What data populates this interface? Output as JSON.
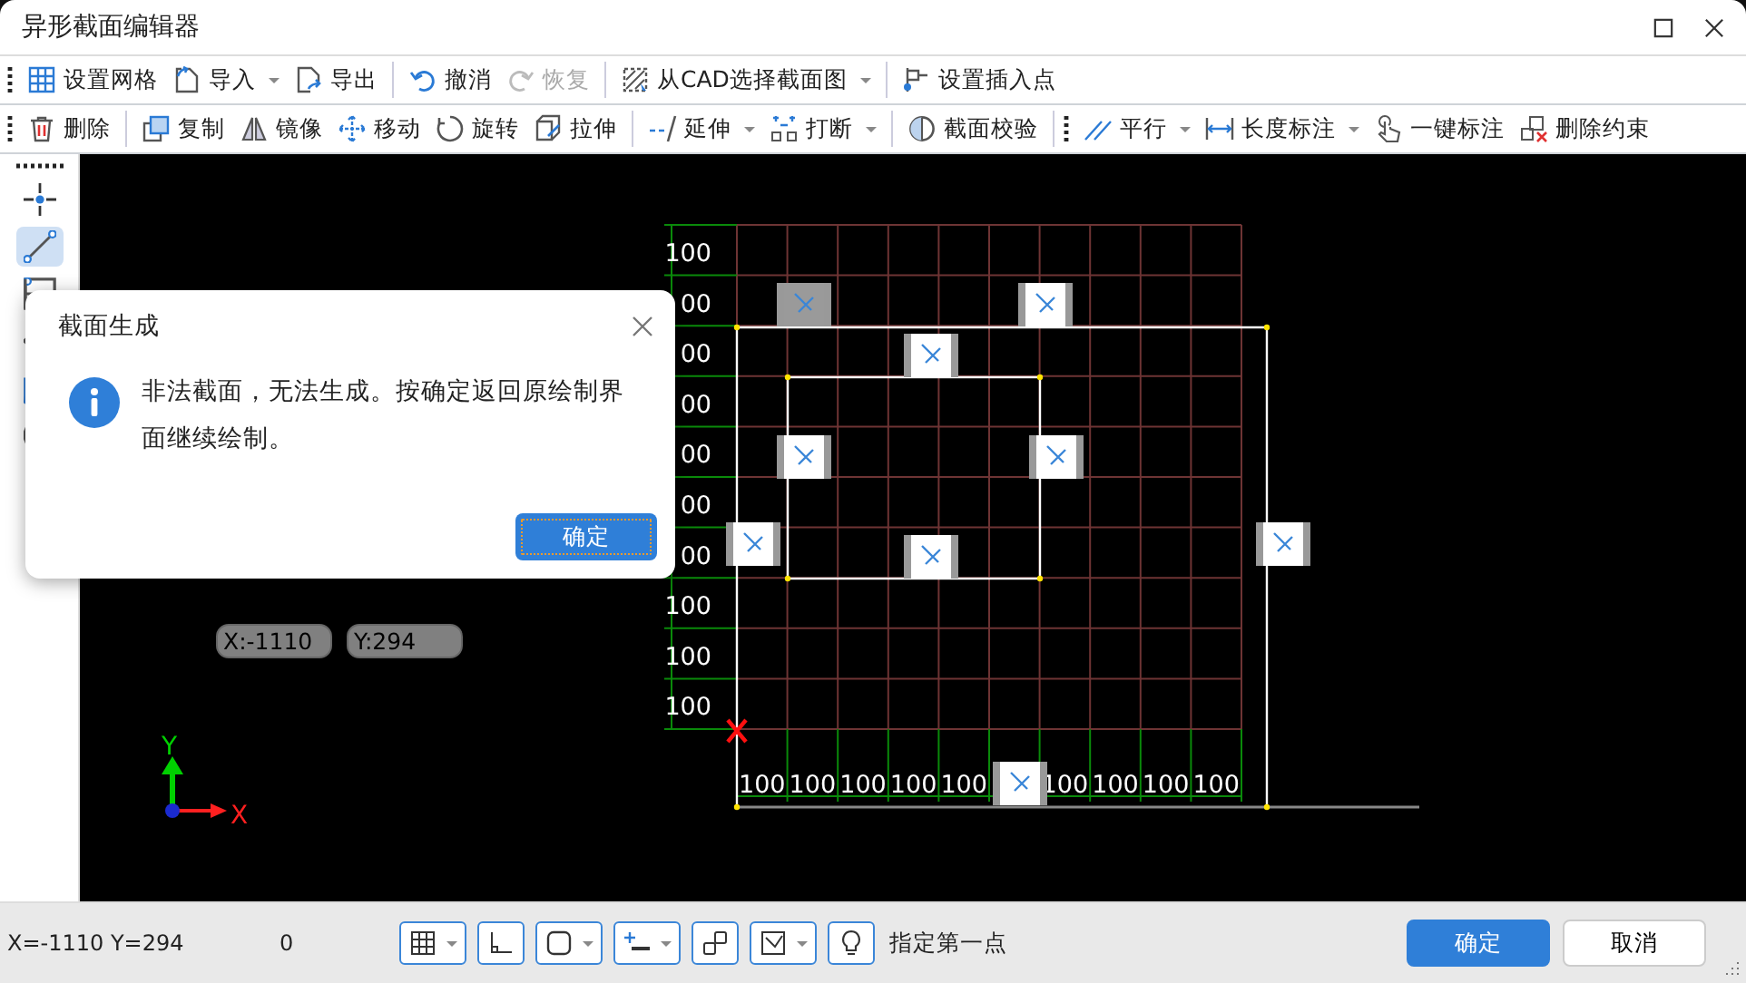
{
  "window": {
    "title": "异形截面编辑器"
  },
  "toolbars": [
    {
      "items": [
        {
          "kind": "grip"
        },
        {
          "kind": "button",
          "label": "设置网格",
          "has_menu": false,
          "disabled": false
        },
        {
          "kind": "button",
          "label": "导入",
          "has_menu": true,
          "disabled": false
        },
        {
          "kind": "button",
          "label": "导出",
          "has_menu": false,
          "disabled": false
        },
        {
          "kind": "separator"
        },
        {
          "kind": "button",
          "label": "撤消",
          "has_menu": false,
          "disabled": false
        },
        {
          "kind": "button",
          "label": "恢复",
          "has_menu": false,
          "disabled": true
        },
        {
          "kind": "separator"
        },
        {
          "kind": "button",
          "label": "从CAD选择截面图",
          "has_menu": true,
          "disabled": false
        },
        {
          "kind": "separator"
        },
        {
          "kind": "button",
          "label": "设置插入点",
          "has_menu": false,
          "disabled": false
        }
      ]
    },
    {
      "items": [
        {
          "kind": "grip"
        },
        {
          "kind": "button",
          "label": "删除",
          "has_menu": false,
          "disabled": false
        },
        {
          "kind": "separator"
        },
        {
          "kind": "button",
          "label": "复制",
          "has_menu": false,
          "disabled": false
        },
        {
          "kind": "button",
          "label": "镜像",
          "has_menu": false,
          "disabled": false
        },
        {
          "kind": "button",
          "label": "移动",
          "has_menu": false,
          "disabled": false
        },
        {
          "kind": "button",
          "label": "旋转",
          "has_menu": false,
          "disabled": false
        },
        {
          "kind": "button",
          "label": "拉伸",
          "has_menu": false,
          "disabled": false
        },
        {
          "kind": "separator"
        },
        {
          "kind": "button",
          "label": "延伸",
          "has_menu": true,
          "disabled": false
        },
        {
          "kind": "button",
          "label": "打断",
          "has_menu": true,
          "disabled": false
        },
        {
          "kind": "separator"
        },
        {
          "kind": "button",
          "label": "截面校验",
          "has_menu": false,
          "disabled": false
        },
        {
          "kind": "separator"
        },
        {
          "kind": "grip"
        },
        {
          "kind": "button",
          "label": "平行",
          "has_menu": true,
          "disabled": false
        },
        {
          "kind": "button",
          "label": "长度标注",
          "has_menu": true,
          "disabled": false
        },
        {
          "kind": "button",
          "label": "一键标注",
          "has_menu": false,
          "disabled": false
        },
        {
          "kind": "button",
          "label": "删除约束",
          "has_menu": false,
          "disabled": false
        }
      ]
    }
  ],
  "tool_palette": [
    {
      "selected": false
    },
    {
      "selected": true
    },
    {
      "selected": false
    },
    {
      "selected": false
    },
    {
      "selected": false
    },
    {
      "selected": false
    }
  ],
  "canvas": {
    "y_labels": [
      "100",
      "00",
      "00",
      "00",
      "00",
      "00",
      "00",
      "100",
      "100",
      "100"
    ],
    "x_labels": [
      "100",
      "100",
      "100",
      "100",
      "100",
      "100",
      "100",
      "100",
      "100"
    ],
    "cursor_x": "X:-1110",
    "cursor_y": "Y:294",
    "axis_y": "Y",
    "axis_x": "X"
  },
  "dialog": {
    "title": "截面生成",
    "message": "非法截面，无法生成。按确定返回原绘制界面继续绘制。",
    "button": "确定"
  },
  "status_bar": {
    "coordinates": "X=-1110 Y=294",
    "count": "0",
    "tools": [
      {
        "has_menu": true
      },
      {
        "has_menu": false
      },
      {
        "has_menu": true
      },
      {
        "has_menu": true
      },
      {
        "has_menu": false
      },
      {
        "has_menu": true
      },
      {
        "has_menu": false
      }
    ],
    "hint": "指定第一点",
    "buttons": [
      {
        "kind": "primary",
        "label": "确定"
      },
      {
        "kind": "secondary",
        "label": "取消"
      }
    ]
  }
}
